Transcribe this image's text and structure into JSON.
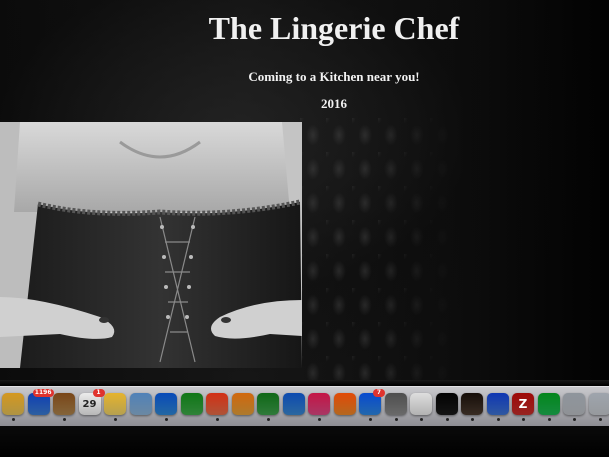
{
  "page": {
    "title": "The Lingerie Chef",
    "tagline": "Coming to a Kitchen near you!",
    "year": "2016"
  },
  "dock": {
    "items": [
      {
        "name": "finder-icon",
        "color": "#e9c55a"
      },
      {
        "name": "mail-icon",
        "color": "#3d7fd6",
        "badge": "1196"
      },
      {
        "name": "contacts-icon",
        "color": "#b0864e"
      },
      {
        "name": "calendar-icon",
        "color": "#f5f5f5",
        "label": "29",
        "badge": "1"
      },
      {
        "name": "notes-icon",
        "color": "#f2d66b"
      },
      {
        "name": "preview-icon",
        "color": "#8fb6d9"
      },
      {
        "name": "safari-icon",
        "color": "#2f8ad9"
      },
      {
        "name": "facetime-icon",
        "color": "#3fae4b"
      },
      {
        "name": "photos-icon",
        "color": "#e86f4a"
      },
      {
        "name": "pages-icon",
        "color": "#e7a33c"
      },
      {
        "name": "numbers-icon",
        "color": "#3fa34d"
      },
      {
        "name": "keynote-icon",
        "color": "#3a8ad4"
      },
      {
        "name": "itunes-icon",
        "color": "#e04a86"
      },
      {
        "name": "ibooks-icon",
        "color": "#f08a2a"
      },
      {
        "name": "app-store-icon",
        "color": "#2e8ae6",
        "badge": "7"
      },
      {
        "name": "system-preferences-icon",
        "color": "#8d8d8d"
      },
      {
        "name": "textedit-icon",
        "color": "#eeeeee"
      },
      {
        "name": "terminal-icon",
        "color": "#1b1b1b"
      },
      {
        "name": "sublime-icon",
        "color": "#4b3b2f"
      },
      {
        "name": "chrome-icon",
        "color": "#3f76d6"
      },
      {
        "name": "filezilla-icon",
        "color": "#c9302c",
        "label": "Z"
      },
      {
        "name": "spotify-icon",
        "color": "#1db954"
      },
      {
        "name": "downloads-icon",
        "color": "#bfc3c8"
      },
      {
        "name": "trash-icon",
        "color": "#c9cdd2"
      }
    ]
  }
}
